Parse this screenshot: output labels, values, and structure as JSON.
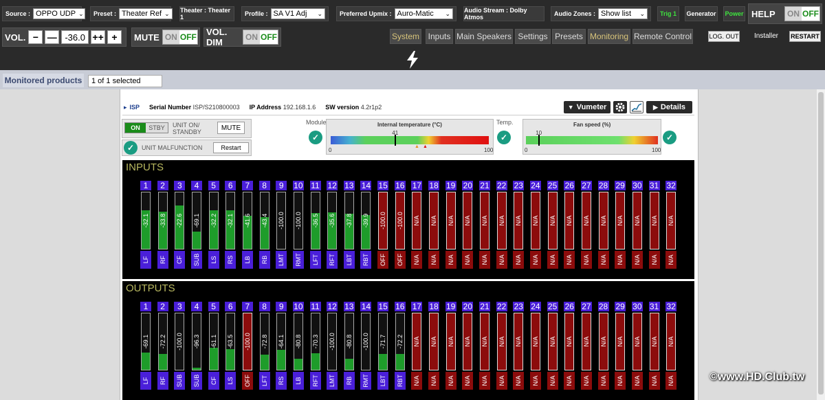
{
  "topbar": {
    "source": {
      "label": "Source :",
      "value": "OPPO UDP"
    },
    "preset": {
      "label": "Preset :",
      "value": "Theater Ref"
    },
    "theater": "Theater : Theater 1",
    "profile": {
      "label": "Profile :",
      "value": "SA V1 Adj"
    },
    "upmix": {
      "label": "Preferred Upmix :",
      "value": "Auro-Matic"
    },
    "audio_stream": "Audio Stream : Dolby Atmos",
    "audio_zones": {
      "label": "Audio Zones :",
      "value": "Show list"
    },
    "trig": "Trig 1",
    "generator": "Generator",
    "power": "Power",
    "help": {
      "label": "HELP",
      "on": "ON",
      "off": "OFF"
    }
  },
  "controls": {
    "vol_label": "VOL.",
    "minus": "−",
    "minus2": "—",
    "vol_value": "-36.0",
    "plus2": "++",
    "plus": "+",
    "mute": {
      "label": "MUTE",
      "on": "ON",
      "off": "OFF"
    },
    "voldim": {
      "label": "VOL. DIM",
      "on": "ON",
      "off": "OFF"
    }
  },
  "nav": {
    "tabs": [
      "System",
      "Inputs",
      "Main Speakers",
      "Settings",
      "Presets",
      "Monitoring",
      "Remote Control"
    ],
    "logout": "LOG. OUT",
    "installer": "Installer",
    "restart": "RESTART"
  },
  "monitored": {
    "title": "Monitored products",
    "selection": "1 of 1 selected"
  },
  "device": {
    "name": "ISP",
    "serial_label": "Serial Number",
    "serial": "ISP/S210800003",
    "ip_label": "IP Address",
    "ip": "192.168.1.6",
    "sw_label": "SW version",
    "sw": "4.2r1p2",
    "vumeter": "Vumeter",
    "details": "Details"
  },
  "status": {
    "on": "ON",
    "stby": "STBY",
    "unit_on_standby": "UNIT ON/ STANDBY",
    "mute": "MUTE",
    "malfunction": "UNIT MALFUNCTION",
    "restart": "Restart",
    "module": "Module",
    "temp": "Temp.",
    "temperature": {
      "title": "Internal temperature (°C)",
      "value": 41,
      "min": 0,
      "max": 100
    },
    "fan": {
      "title": "Fan speed (%)",
      "value": 10,
      "min": 0,
      "max": 100
    }
  },
  "inputs": {
    "title": "INPUTS",
    "channels": [
      {
        "n": "1",
        "v": "-32.1",
        "l": "LF",
        "s": "ok"
      },
      {
        "n": "2",
        "v": "-33.8",
        "l": "RF",
        "s": "ok"
      },
      {
        "n": "3",
        "v": "-22.6",
        "l": "CF",
        "s": "ok"
      },
      {
        "n": "4",
        "v": "-69.1",
        "l": "SUB",
        "s": "ok"
      },
      {
        "n": "5",
        "v": "-32.2",
        "l": "LS",
        "s": "ok"
      },
      {
        "n": "6",
        "v": "-32.1",
        "l": "RS",
        "s": "ok"
      },
      {
        "n": "7",
        "v": "-41.6",
        "l": "LB",
        "s": "ok"
      },
      {
        "n": "8",
        "v": "-43.4",
        "l": "RB",
        "s": "ok"
      },
      {
        "n": "9",
        "v": "-100.0",
        "l": "LMT",
        "s": "ok"
      },
      {
        "n": "10",
        "v": "-100.0",
        "l": "RMT",
        "s": "ok"
      },
      {
        "n": "11",
        "v": "-36.5",
        "l": "LFT",
        "s": "ok"
      },
      {
        "n": "12",
        "v": "-35.6",
        "l": "RFT",
        "s": "ok"
      },
      {
        "n": "13",
        "v": "-37.8",
        "l": "LBT",
        "s": "ok"
      },
      {
        "n": "14",
        "v": "-39.9",
        "l": "RBT",
        "s": "ok"
      },
      {
        "n": "15",
        "v": "-100.0",
        "l": "OFF",
        "s": "off"
      },
      {
        "n": "16",
        "v": "-100.0",
        "l": "OFF",
        "s": "off"
      },
      {
        "n": "17",
        "v": "N/A",
        "l": "N/A",
        "s": "na"
      },
      {
        "n": "18",
        "v": "N/A",
        "l": "N/A",
        "s": "na"
      },
      {
        "n": "19",
        "v": "N/A",
        "l": "N/A",
        "s": "na"
      },
      {
        "n": "20",
        "v": "N/A",
        "l": "N/A",
        "s": "na"
      },
      {
        "n": "21",
        "v": "N/A",
        "l": "N/A",
        "s": "na"
      },
      {
        "n": "22",
        "v": "N/A",
        "l": "N/A",
        "s": "na"
      },
      {
        "n": "23",
        "v": "N/A",
        "l": "N/A",
        "s": "na"
      },
      {
        "n": "24",
        "v": "N/A",
        "l": "N/A",
        "s": "na"
      },
      {
        "n": "25",
        "v": "N/A",
        "l": "N/A",
        "s": "na"
      },
      {
        "n": "26",
        "v": "N/A",
        "l": "N/A",
        "s": "na"
      },
      {
        "n": "27",
        "v": "N/A",
        "l": "N/A",
        "s": "na"
      },
      {
        "n": "28",
        "v": "N/A",
        "l": "N/A",
        "s": "na"
      },
      {
        "n": "29",
        "v": "N/A",
        "l": "N/A",
        "s": "na"
      },
      {
        "n": "30",
        "v": "N/A",
        "l": "N/A",
        "s": "na"
      },
      {
        "n": "31",
        "v": "N/A",
        "l": "N/A",
        "s": "na"
      },
      {
        "n": "32",
        "v": "N/A",
        "l": "N/A",
        "s": "na"
      }
    ]
  },
  "outputs": {
    "title": "OUTPUTS",
    "channels": [
      {
        "n": "1",
        "v": "-69.1",
        "l": "LF",
        "s": "ok"
      },
      {
        "n": "2",
        "v": "-72.2",
        "l": "RF",
        "s": "ok"
      },
      {
        "n": "3",
        "v": "-100.0",
        "l": "SUB",
        "s": "ok"
      },
      {
        "n": "4",
        "v": "-96.3",
        "l": "SUB",
        "s": "ok"
      },
      {
        "n": "5",
        "v": "-61.1",
        "l": "CF",
        "s": "ok"
      },
      {
        "n": "6",
        "v": "-63.5",
        "l": "LS",
        "s": "ok"
      },
      {
        "n": "7",
        "v": "-100.0",
        "l": "OFF",
        "s": "off"
      },
      {
        "n": "8",
        "v": "-72.8",
        "l": "LFT",
        "s": "ok"
      },
      {
        "n": "9",
        "v": "-64.1",
        "l": "RS",
        "s": "ok"
      },
      {
        "n": "10",
        "v": "-80.8",
        "l": "LB",
        "s": "ok"
      },
      {
        "n": "11",
        "v": "-70.3",
        "l": "RFT",
        "s": "ok"
      },
      {
        "n": "12",
        "v": "-100.0",
        "l": "LMT",
        "s": "ok"
      },
      {
        "n": "13",
        "v": "-80.8",
        "l": "RB",
        "s": "ok"
      },
      {
        "n": "14",
        "v": "-100.0",
        "l": "RMT",
        "s": "ok"
      },
      {
        "n": "15",
        "v": "-71.7",
        "l": "LBT",
        "s": "ok"
      },
      {
        "n": "16",
        "v": "-72.2",
        "l": "RBT",
        "s": "ok"
      },
      {
        "n": "17",
        "v": "N/A",
        "l": "N/A",
        "s": "na"
      },
      {
        "n": "18",
        "v": "N/A",
        "l": "N/A",
        "s": "na"
      },
      {
        "n": "19",
        "v": "N/A",
        "l": "N/A",
        "s": "na"
      },
      {
        "n": "20",
        "v": "N/A",
        "l": "N/A",
        "s": "na"
      },
      {
        "n": "21",
        "v": "N/A",
        "l": "N/A",
        "s": "na"
      },
      {
        "n": "22",
        "v": "N/A",
        "l": "N/A",
        "s": "na"
      },
      {
        "n": "23",
        "v": "N/A",
        "l": "N/A",
        "s": "na"
      },
      {
        "n": "24",
        "v": "N/A",
        "l": "N/A",
        "s": "na"
      },
      {
        "n": "25",
        "v": "N/A",
        "l": "N/A",
        "s": "na"
      },
      {
        "n": "26",
        "v": "N/A",
        "l": "N/A",
        "s": "na"
      },
      {
        "n": "27",
        "v": "N/A",
        "l": "N/A",
        "s": "na"
      },
      {
        "n": "28",
        "v": "N/A",
        "l": "N/A",
        "s": "na"
      },
      {
        "n": "29",
        "v": "N/A",
        "l": "N/A",
        "s": "na"
      },
      {
        "n": "30",
        "v": "N/A",
        "l": "N/A",
        "s": "na"
      },
      {
        "n": "31",
        "v": "N/A",
        "l": "N/A",
        "s": "na"
      },
      {
        "n": "32",
        "v": "N/A",
        "l": "N/A",
        "s": "na"
      }
    ]
  },
  "colors": {
    "channel_blue": "#4a1fd9",
    "level_green": "#1e9c2a",
    "alert_red": "#8c0c0c",
    "check_teal": "#1a9c82"
  },
  "watermark": "©www.HD.Club.tw"
}
